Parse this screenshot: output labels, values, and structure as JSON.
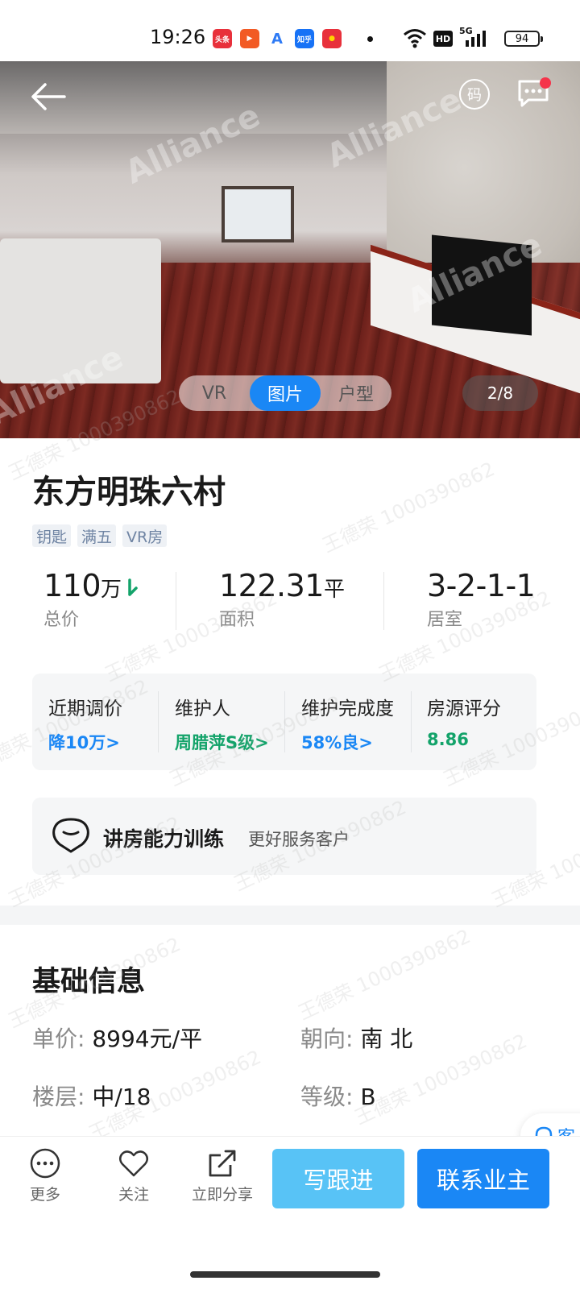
{
  "status_bar": {
    "time": "19:26",
    "battery": "94",
    "apps": [
      {
        "name": "toutiao-icon",
        "label": "头条",
        "color": "#e8303b"
      },
      {
        "name": "video-player-icon",
        "label": "▶",
        "color": "#f25a24"
      },
      {
        "name": "a-app-icon",
        "label": "A",
        "color": "#2f7bf5"
      },
      {
        "name": "zhihu-icon",
        "label": "知乎",
        "color": "#1772f6"
      },
      {
        "name": "red-app-icon",
        "label": "●",
        "color": "#e8303b"
      }
    ],
    "network": "5G",
    "hd": "HD"
  },
  "hero": {
    "media_tabs": [
      "VR",
      "图片",
      "户型"
    ],
    "active_tab": "图片",
    "counter": "2/8",
    "watermark": "Alliance"
  },
  "header": {
    "qr_label": "码"
  },
  "listing": {
    "title": "东方明珠六村",
    "tags": [
      "钥匙",
      "满五",
      "VR房"
    ],
    "stats": [
      {
        "value": "110",
        "unit": "万",
        "label": "总价"
      },
      {
        "value": "122.31",
        "unit": "平",
        "label": "面积"
      },
      {
        "value": "3-2-1-1",
        "unit": "",
        "label": "居室"
      }
    ]
  },
  "metrics": [
    {
      "label": "近期调价",
      "value": "降10万>",
      "color": "#1a87f5"
    },
    {
      "label": "维护人",
      "value": "周腊萍S级>",
      "color": "#13a36a"
    },
    {
      "label": "维护完成度",
      "value": "58%良>",
      "color": "#1a87f5"
    },
    {
      "label": "房源评分",
      "value": "8.86",
      "color": "#13a36a"
    }
  ],
  "training": {
    "title": "讲房能力训练",
    "subtitle": "更好服务客户"
  },
  "basic_info": {
    "title": "基础信息",
    "items": [
      {
        "key": "单价:",
        "value": "8994元/平"
      },
      {
        "key": "朝向:",
        "value": "南 北"
      },
      {
        "key": "楼层:",
        "value": "中/18"
      },
      {
        "key": "等级:",
        "value": "B"
      }
    ]
  },
  "service": {
    "label": "客"
  },
  "bottom_bar": {
    "more": "更多",
    "follow": "关注",
    "share": "立即分享",
    "write_followup": "写跟进",
    "contact_owner": "联系业主"
  },
  "watermark_text": "王德荣 1000390862"
}
